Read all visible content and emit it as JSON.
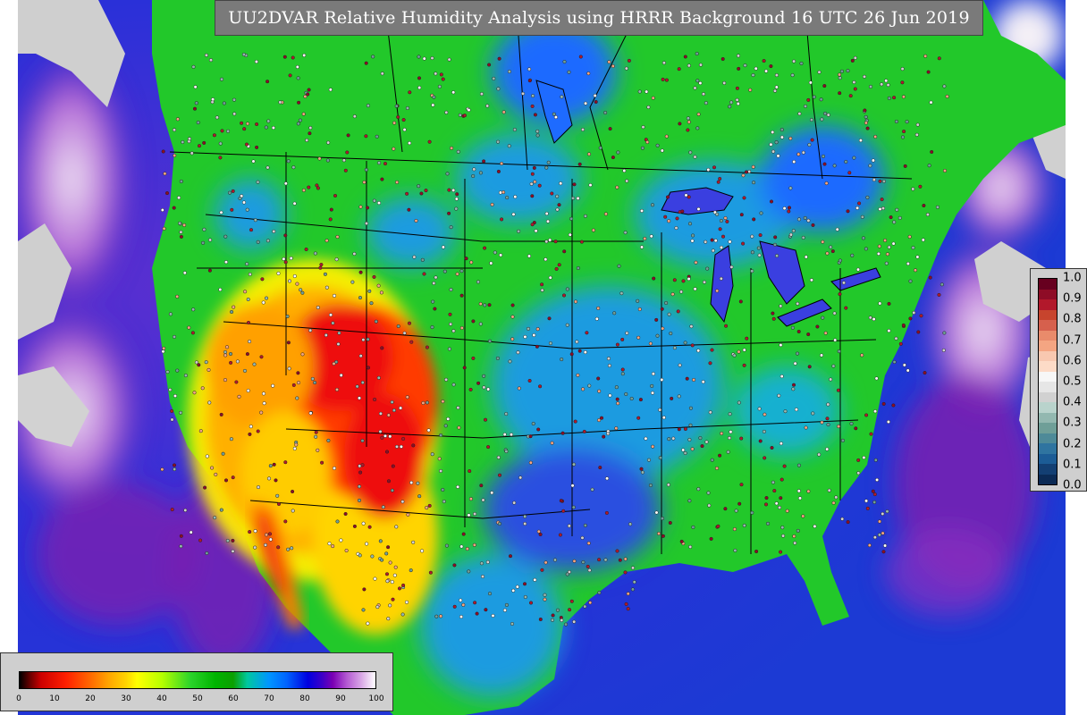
{
  "title": "UU2DVAR Relative Humidity Analysis using HRRR Background 16 UTC 26 Jun 2019",
  "rh_colorbar": {
    "label_values": [
      "0",
      "10",
      "20",
      "30",
      "40",
      "50",
      "60",
      "70",
      "80",
      "90",
      "100"
    ],
    "min": 0,
    "max": 100
  },
  "ratio_colorbar": {
    "label_values": [
      "1.0",
      "0.9",
      "0.8",
      "0.7",
      "0.6",
      "0.5",
      "0.4",
      "0.3",
      "0.2",
      "0.1",
      "0.0"
    ],
    "colors": [
      "#67001f",
      "#8e0c26",
      "#b2182b",
      "#c7442d",
      "#d6604d",
      "#e98b6b",
      "#f4a582",
      "#f8c8b0",
      "#fddbc7",
      "#f7f7f7",
      "#e6e6e6",
      "#d1d1d1",
      "#b9d3cc",
      "#93b8b0",
      "#6f9f98",
      "#4e8a98",
      "#2f74a0",
      "#1c5c96",
      "#133f73",
      "#0b2a55"
    ]
  },
  "colors": {
    "ocean": "#2438d6",
    "ocean_purple": "#7a1fb0",
    "land_green": "#22c82a",
    "land_blue": "#1a9be0",
    "dry_red": "#ee1010",
    "dry_orange": "#ff9b00",
    "dry_yellow": "#fff000"
  }
}
